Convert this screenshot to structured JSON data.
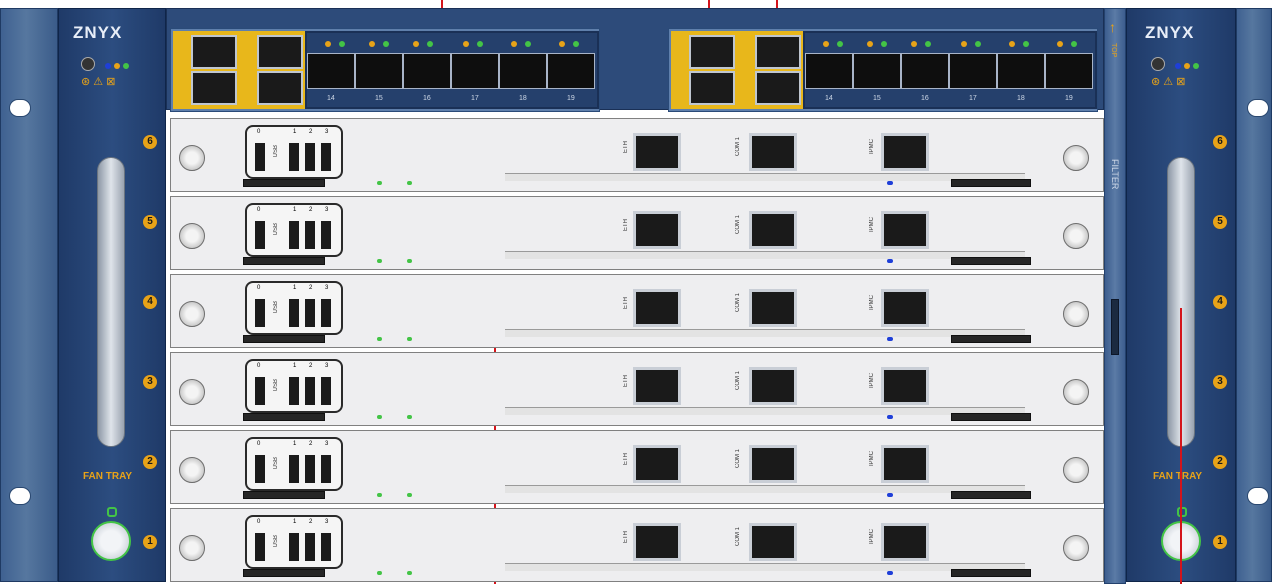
{
  "brand": {
    "logo_text": "ZNYX"
  },
  "fan_trays": [
    {
      "label": "FAN TRAY",
      "numbers": [
        "6",
        "5",
        "4",
        "3",
        "2",
        "1"
      ]
    },
    {
      "label": "FAN TRAY",
      "numbers": [
        "6",
        "5",
        "4",
        "3",
        "2",
        "1"
      ]
    }
  ],
  "center_column": {
    "top_label": "TOP",
    "filter_label": "FILTER"
  },
  "switch_cards": [
    {
      "port_numbers": [
        "14",
        "15",
        "16",
        "17",
        "18",
        "19"
      ]
    },
    {
      "port_numbers": [
        "14",
        "15",
        "16",
        "17",
        "18",
        "19"
      ]
    }
  ],
  "blades": {
    "usb_label": "USB",
    "usb_numbers": [
      "0",
      "1",
      "2",
      "3"
    ],
    "eth_label": "ETH",
    "com_label": "COM 1",
    "ipmc_label": "IPMC",
    "count": 6
  },
  "colors": {
    "chassis_blue": "#3f6191",
    "accent_orange": "#e8a318",
    "led_green": "#43c446",
    "led_blue": "#1f3fd8",
    "callout_red": "#d4141b"
  },
  "icons": [
    "screw-icon",
    "lock-icon",
    "warning-icon",
    "arrow-up-icon",
    "led-icon"
  ]
}
